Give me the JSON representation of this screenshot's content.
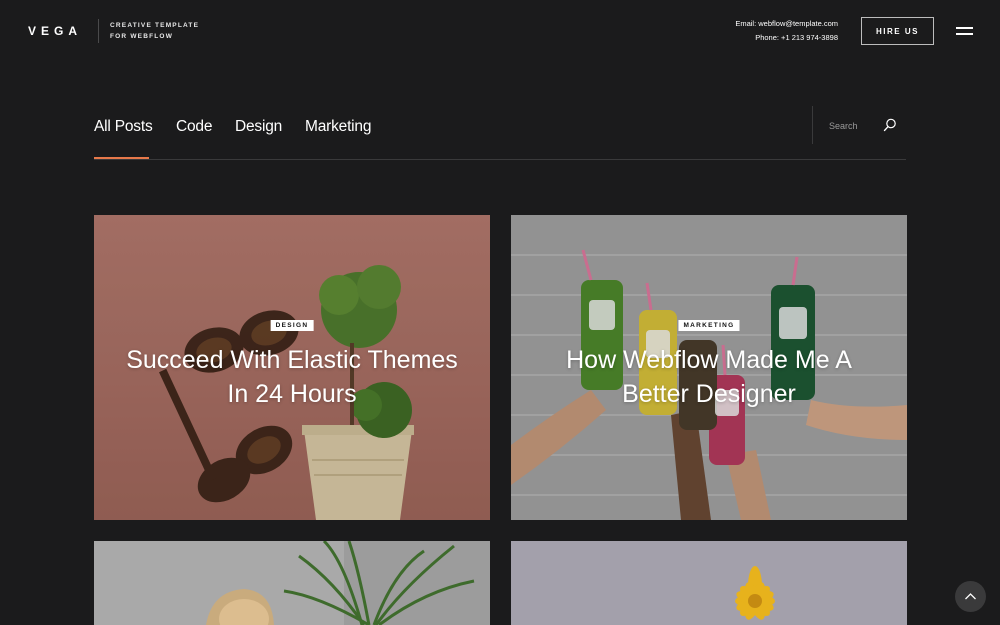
{
  "header": {
    "logo": "VEGA",
    "tagline_line1": "CREATIVE TEMPLATE",
    "tagline_line2": "FOR WEBFLOW",
    "email": "Email:  webflow@template.com",
    "phone": "Phone:  +1 213 974-3898",
    "hire_label": "HIRE US"
  },
  "tabs": [
    {
      "label": "All Posts",
      "active": true
    },
    {
      "label": "Code"
    },
    {
      "label": "Design"
    },
    {
      "label": "Marketing"
    }
  ],
  "search": {
    "placeholder": "Search",
    "icon": "search-icon"
  },
  "posts": [
    {
      "tag": "DESIGN",
      "title": "Succeed With Elastic Themes In 24 Hours",
      "image": "sunglasses and potted plant on pink background"
    },
    {
      "tag": "MARKETING",
      "title": "How Webflow Made Me A Better Designer",
      "image": "hands holding juice bottles against white brick wall"
    },
    {
      "tag": "",
      "title": "",
      "image": "blonde woman with green plants"
    },
    {
      "tag": "",
      "title": "",
      "image": "yellow flower on lavender background"
    }
  ],
  "back_to_top": {
    "icon": "chevron-up-icon"
  },
  "colors": {
    "background": "#1b1b1c",
    "accent": "#e8794a"
  }
}
